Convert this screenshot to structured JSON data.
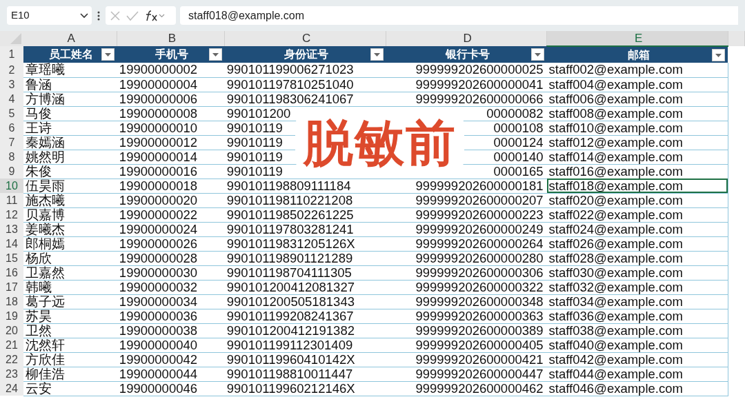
{
  "formula_bar": {
    "name_box": "E10",
    "formula": "staff018@example.com"
  },
  "columns": [
    {
      "letter": "A",
      "header": "员工姓名",
      "selected": false
    },
    {
      "letter": "B",
      "header": "手机号",
      "selected": false
    },
    {
      "letter": "C",
      "header": "身份证号",
      "selected": false
    },
    {
      "letter": "D",
      "header": "银行卡号",
      "selected": false
    },
    {
      "letter": "E",
      "header": "邮箱",
      "selected": true
    }
  ],
  "header_row": "1",
  "rows": [
    {
      "number": "2",
      "selected": false,
      "cells": [
        "章瑶曦",
        "19900000002",
        "990101199006271023",
        "999999202600000025",
        "staff002@example.com"
      ]
    },
    {
      "number": "3",
      "selected": false,
      "cells": [
        "鲁涵",
        "19900000004",
        "990101197810251040",
        "999999202600000041",
        "staff004@example.com"
      ]
    },
    {
      "number": "4",
      "selected": false,
      "cells": [
        "方博涵",
        "19900000006",
        "990101198306241067",
        "999999202600000066",
        "staff006@example.com"
      ]
    },
    {
      "number": "5",
      "selected": false,
      "cells": [
        "马俊",
        "19900000008",
        "990101200",
        "00000082",
        "staff008@example.com"
      ]
    },
    {
      "number": "6",
      "selected": false,
      "cells": [
        "王诗",
        "19900000010",
        "99010119",
        "0000108",
        "staff010@example.com"
      ]
    },
    {
      "number": "7",
      "selected": false,
      "cells": [
        "秦嫣涵",
        "19900000012",
        "99010119",
        "0000124",
        "staff012@example.com"
      ]
    },
    {
      "number": "8",
      "selected": false,
      "cells": [
        "姚然明",
        "19900000014",
        "99010119",
        "0000140",
        "staff014@example.com"
      ]
    },
    {
      "number": "9",
      "selected": false,
      "cells": [
        "朱俊",
        "19900000016",
        "99010119",
        "0000165",
        "staff016@example.com"
      ]
    },
    {
      "number": "10",
      "selected": true,
      "cells": [
        "伍昊雨",
        "19900000018",
        "990101198809111184",
        "999999202600000181",
        "staff018@example.com"
      ]
    },
    {
      "number": "11",
      "selected": false,
      "cells": [
        "施杰曦",
        "19900000020",
        "990101198110221208",
        "999999202600000207",
        "staff020@example.com"
      ]
    },
    {
      "number": "12",
      "selected": false,
      "cells": [
        "贝嘉博",
        "19900000022",
        "990101198502261225",
        "999999202600000223",
        "staff022@example.com"
      ]
    },
    {
      "number": "13",
      "selected": false,
      "cells": [
        "姜曦杰",
        "19900000024",
        "990101197803281241",
        "999999202600000249",
        "staff024@example.com"
      ]
    },
    {
      "number": "14",
      "selected": false,
      "cells": [
        "郎桐嫣",
        "19900000026",
        "99010119831205126X",
        "999999202600000264",
        "staff026@example.com"
      ]
    },
    {
      "number": "15",
      "selected": false,
      "cells": [
        "杨欣",
        "19900000028",
        "990101198901121289",
        "999999202600000280",
        "staff028@example.com"
      ]
    },
    {
      "number": "16",
      "selected": false,
      "cells": [
        "卫嘉然",
        "19900000030",
        "990101198704111305",
        "999999202600000306",
        "staff030@example.com"
      ]
    },
    {
      "number": "17",
      "selected": false,
      "cells": [
        "韩曦",
        "19900000032",
        "990101200412081327",
        "999999202600000322",
        "staff032@example.com"
      ]
    },
    {
      "number": "18",
      "selected": false,
      "cells": [
        "葛子远",
        "19900000034",
        "990101200505181343",
        "999999202600000348",
        "staff034@example.com"
      ]
    },
    {
      "number": "19",
      "selected": false,
      "cells": [
        "苏昊",
        "19900000036",
        "990101199208241367",
        "999999202600000363",
        "staff036@example.com"
      ]
    },
    {
      "number": "20",
      "selected": false,
      "cells": [
        "卫然",
        "19900000038",
        "990101200412191382",
        "999999202600000389",
        "staff038@example.com"
      ]
    },
    {
      "number": "21",
      "selected": false,
      "cells": [
        "沈然轩",
        "19900000040",
        "990101199112301409",
        "999999202600000405",
        "staff040@example.com"
      ]
    },
    {
      "number": "22",
      "selected": false,
      "cells": [
        "方欣佳",
        "19900000042",
        "99010119960410142X",
        "999999202600000421",
        "staff042@example.com"
      ]
    },
    {
      "number": "23",
      "selected": false,
      "cells": [
        "柳佳浩",
        "19900000044",
        "990101198810011447",
        "999999202600000447",
        "staff044@example.com"
      ]
    },
    {
      "number": "24",
      "selected": false,
      "cells": [
        "云安",
        "19900000046",
        "99010119960212146X",
        "999999202600000462",
        "staff046@example.com"
      ]
    }
  ],
  "overlay": {
    "text": "脱敏前"
  }
}
